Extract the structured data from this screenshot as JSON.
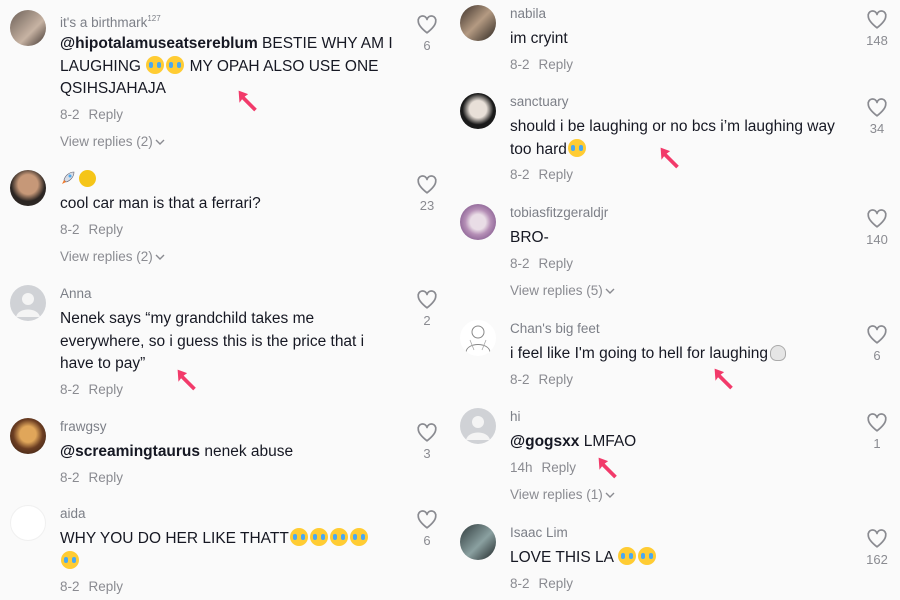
{
  "left": [
    {
      "user": "it's a birthmark",
      "user_sup": "127",
      "mention": "@hipotalamuseatsereblum",
      "text": " BESTIE WHY AM I LAUGHING ",
      "text2": " MY OPAH ALSO USE ONE QSIHSJAHAJA",
      "date": "8-2",
      "reply": "Reply",
      "view_replies": "View replies (2)",
      "likes": "6"
    },
    {
      "user": "",
      "mention": "",
      "text": "cool car man is that a ferrari?",
      "date": "8-2",
      "reply": "Reply",
      "view_replies": "View replies (2)",
      "likes": "23"
    },
    {
      "user": "Anna",
      "mention": "",
      "text": "Nenek says “my grandchild takes me everywhere, so i guess this is the price that i have to pay”",
      "date": "8-2",
      "reply": "Reply",
      "likes": "2"
    },
    {
      "user": "frawgsy",
      "mention": "@screamingtaurus",
      "text": " nenek abuse",
      "date": "8-2",
      "reply": "Reply",
      "likes": "3"
    },
    {
      "user": "aida",
      "mention": "",
      "text": "WHY YOU DO HER LIKE THATT",
      "date": "8-2",
      "reply": "Reply",
      "likes": "6"
    }
  ],
  "right": [
    {
      "user": "nabila",
      "mention": "",
      "text": "im cryint",
      "date": "8-2",
      "reply": "Reply",
      "likes": "148"
    },
    {
      "user": "sanctuary",
      "mention": "",
      "text": "should i be laughing or no bcs i’m laughing way too hard",
      "date": "8-2",
      "reply": "Reply",
      "likes": "34"
    },
    {
      "user": "tobiasfitzgeraldjr",
      "mention": "",
      "text": "BRO-",
      "date": "8-2",
      "reply": "Reply",
      "view_replies": "View replies (5)",
      "likes": "140"
    },
    {
      "user": "Chan's big feet",
      "mention": "",
      "text": "i feel like I'm going to hell for laughing",
      "date": "8-2",
      "reply": "Reply",
      "likes": "6"
    },
    {
      "user": "hi",
      "mention": "@gogsxx",
      "text": " LMFAO",
      "date": "14h",
      "reply": "Reply",
      "view_replies": "View replies (1)",
      "likes": "1"
    },
    {
      "user": "Isaac Lim",
      "mention": "",
      "text": "LOVE THIS LA ",
      "date": "8-2",
      "reply": "Reply",
      "likes": "162"
    }
  ],
  "colors": {
    "arrow": "#f23a6a",
    "meta": "#8a8b91",
    "text": "#161823"
  }
}
